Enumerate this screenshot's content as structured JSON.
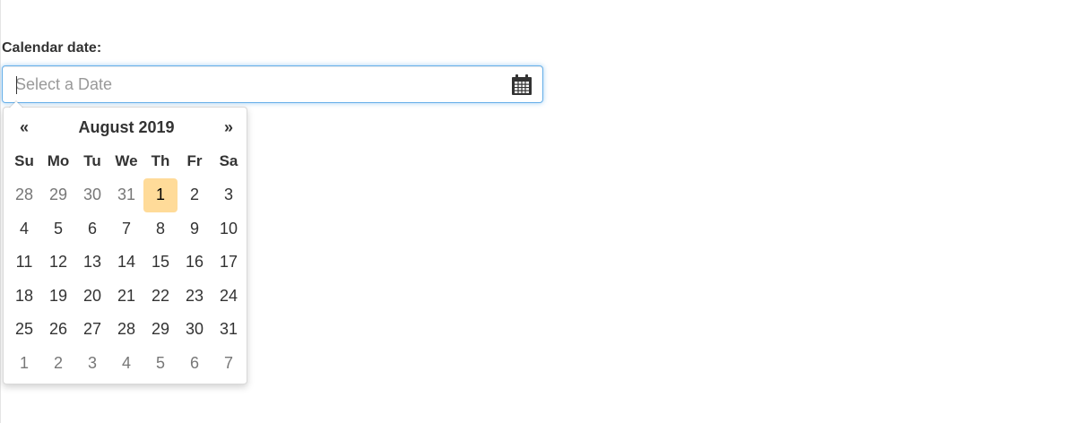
{
  "form": {
    "label": "Calendar date:",
    "input": {
      "value": "",
      "placeholder": "Select a Date"
    },
    "icon": "calendar-icon"
  },
  "datepicker": {
    "prev_label": "«",
    "next_label": "»",
    "month_title": "August 2019",
    "weekdays": [
      "Su",
      "Mo",
      "Tu",
      "We",
      "Th",
      "Fr",
      "Sa"
    ],
    "weeks": [
      [
        "28",
        "29",
        "30",
        "31",
        "1",
        "2",
        "3"
      ],
      [
        "4",
        "5",
        "6",
        "7",
        "8",
        "9",
        "10"
      ],
      [
        "11",
        "12",
        "13",
        "14",
        "15",
        "16",
        "17"
      ],
      [
        "18",
        "19",
        "20",
        "21",
        "22",
        "23",
        "24"
      ],
      [
        "25",
        "26",
        "27",
        "28",
        "29",
        "30",
        "31"
      ],
      [
        "1",
        "2",
        "3",
        "4",
        "5",
        "6",
        "7"
      ]
    ],
    "today_highlight_color": "#ffdb99",
    "muted_day_color": "#777777"
  },
  "colors": {
    "focus_border": "#66afe9",
    "text": "#333333",
    "placeholder": "#999999"
  }
}
